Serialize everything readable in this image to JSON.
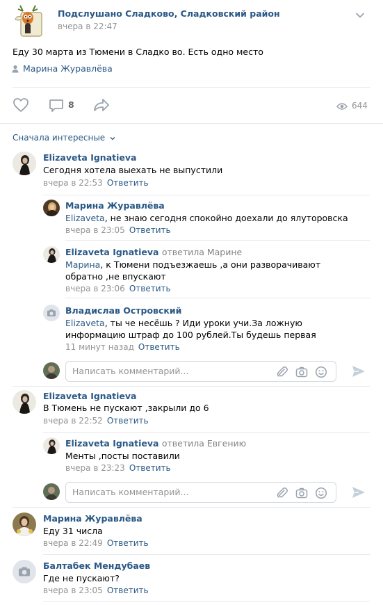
{
  "post": {
    "group_name": "Подслушано Сладково, Сладковский район",
    "time": "вчера в 22:47",
    "text": "Еду 30 марта из Тюмени в Сладко во. Есть одно место",
    "author": "Марина Журавлёва",
    "comments_count": "8",
    "views": "644"
  },
  "sort_label": "Сначала интересные",
  "reply_label": "Ответить",
  "input_placeholder": "Написать комментарий...",
  "comments": [
    {
      "name": "Elizaveta Ignatieva",
      "text": "Сегодня хотела выехать не выпустили",
      "time": "вчера в 22:53",
      "replies": [
        {
          "name": "Марина Журавлёва",
          "mention": "Elizaveta",
          "text": ", не знаю сегодня спокойно доехали до ялуторовска",
          "time": "вчера в 23:05"
        },
        {
          "name": "Elizaveta Ignatieva",
          "replied_to": "ответила Марине",
          "mention": "Марина",
          "text": ", к Тюмени подъезжаешь ,а они разворачивают обратно ,не впускают",
          "time": "вчера в 23:06"
        },
        {
          "name": "Владислав Островский",
          "mention": "Elizaveta",
          "text": ", ты че несёшь ? Иди уроки учи.За ложную информацию штраф до 100 рублей.Ты будешь первая",
          "time": "11 минут назад"
        }
      ]
    },
    {
      "name": "Elizaveta Ignatieva",
      "text": "В Тюмень не пускают ,закрыли до 6",
      "time": "вчера в 22:52",
      "replies": [
        {
          "name": "Elizaveta Ignatieva",
          "replied_to": "ответила Евгению",
          "text": "Менты ,посты поставили",
          "time": "вчера в 23:23"
        }
      ]
    },
    {
      "name": "Марина Журавлёва",
      "text": "Еду 31 числа",
      "time": "вчера в 22:49"
    },
    {
      "name": "Балтабек Мендубаев",
      "text": "Где не пускают?",
      "time": "вчера в 23:05"
    }
  ],
  "colors": {
    "link": "#2a5885",
    "meta": "#939393",
    "separator": "#e7e8ec",
    "icon": "#99a2ad"
  }
}
